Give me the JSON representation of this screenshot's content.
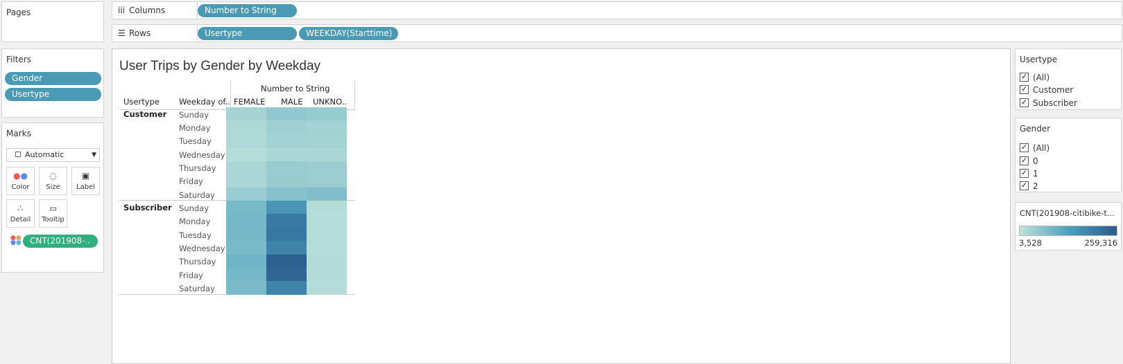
{
  "pages": {
    "label": "Pages"
  },
  "columns": {
    "label": "Columns",
    "icon": "columns-icon",
    "pills": [
      "Number to String"
    ]
  },
  "rows": {
    "label": "Rows",
    "icon": "rows-icon",
    "pills": [
      "Usertype",
      "WEEKDAY(Starttime)"
    ]
  },
  "filters": {
    "label": "Filters",
    "pills": [
      "Gender",
      "Usertype"
    ]
  },
  "marks": {
    "label": "Marks",
    "mark_type": "Automatic",
    "buttons": [
      {
        "label": "Color",
        "icon": "color-icon"
      },
      {
        "label": "Size",
        "icon": "size-icon"
      },
      {
        "label": "Label",
        "icon": "label-icon"
      },
      {
        "label": "Detail",
        "icon": "detail-icon"
      },
      {
        "label": "Tooltip",
        "icon": "tooltip-icon"
      }
    ],
    "color_pill": "CNT(201908-.."
  },
  "view": {
    "title": "User Trips by Gender by Weekday",
    "col_group_header": "Number to String",
    "row_header_1": "Usertype",
    "row_header_2": "Weekday of..",
    "col_headers": [
      "FEMALE",
      "MALE",
      "UNKNO.."
    ]
  },
  "heatmap": {
    "groups": [
      {
        "usertype": "Customer",
        "days": [
          "Sunday",
          "Monday",
          "Tuesday",
          "Wednesday",
          "Thursday",
          "Friday",
          "Saturday"
        ],
        "shades": [
          [
            0.12,
            0.22,
            0.2
          ],
          [
            0.08,
            0.16,
            0.14
          ],
          [
            0.08,
            0.14,
            0.13
          ],
          [
            0.05,
            0.1,
            0.1
          ],
          [
            0.1,
            0.19,
            0.17
          ],
          [
            0.1,
            0.19,
            0.17
          ],
          [
            0.18,
            0.27,
            0.3
          ]
        ]
      },
      {
        "usertype": "Subscriber",
        "days": [
          "Sunday",
          "Monday",
          "Tuesday",
          "Wednesday",
          "Thursday",
          "Friday",
          "Saturday"
        ],
        "shades": [
          [
            0.34,
            0.62,
            0.06
          ],
          [
            0.35,
            0.8,
            0.05
          ],
          [
            0.35,
            0.82,
            0.05
          ],
          [
            0.33,
            0.74,
            0.05
          ],
          [
            0.38,
            0.97,
            0.06
          ],
          [
            0.36,
            0.93,
            0.06
          ],
          [
            0.33,
            0.74,
            0.05
          ]
        ]
      }
    ]
  },
  "usertype_legend": {
    "title": "Usertype",
    "items": [
      "(All)",
      "Customer",
      "Subscriber"
    ]
  },
  "gender_legend": {
    "title": "Gender",
    "items": [
      "(All)",
      "0",
      "1",
      "2"
    ]
  },
  "color_legend": {
    "title": "CNT(201908-citibike-t...",
    "min_label": "3,528",
    "max_label": "259,316",
    "color_low": "#bfe3da",
    "color_high": "#2a5b8b"
  }
}
